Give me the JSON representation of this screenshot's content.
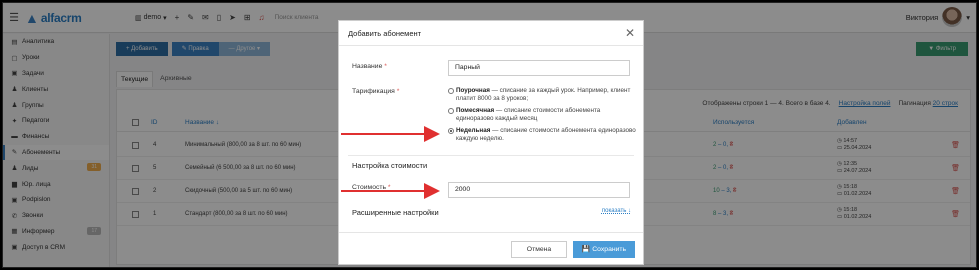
{
  "header": {
    "logo": "alfacrm",
    "branch": "demo",
    "search_placeholder": "Поиск клиента",
    "user_name": "Виктория"
  },
  "sidebar": {
    "items": [
      {
        "label": "Аналитика",
        "icon": "analytics-icon",
        "glyph": "▤"
      },
      {
        "label": "Уроки",
        "icon": "calendar-icon",
        "glyph": "▢"
      },
      {
        "label": "Задачи",
        "icon": "tasks-icon",
        "glyph": "▣"
      },
      {
        "label": "Клиенты",
        "icon": "user-icon",
        "glyph": "♟"
      },
      {
        "label": "Группы",
        "icon": "group-icon",
        "glyph": "♟"
      },
      {
        "label": "Педагоги",
        "icon": "teacher-icon",
        "glyph": "✦"
      },
      {
        "label": "Финансы",
        "icon": "money-icon",
        "glyph": "▬"
      },
      {
        "label": "Абонементы",
        "icon": "subscription-icon",
        "glyph": "✎",
        "active": true
      },
      {
        "label": "Лиды",
        "icon": "leads-icon",
        "glyph": "♟",
        "badge": "31"
      },
      {
        "label": "Юр. лица",
        "icon": "company-icon",
        "glyph": "▆"
      },
      {
        "label": "Podpislon",
        "icon": "sign-icon",
        "glyph": "▣"
      },
      {
        "label": "Звонки",
        "icon": "phone-icon",
        "glyph": "✆"
      },
      {
        "label": "Информер",
        "icon": "informer-icon",
        "glyph": "▦",
        "badge": "17",
        "badge_gray": true
      },
      {
        "label": "Доступ в CRM",
        "icon": "lock-icon",
        "glyph": "▣"
      }
    ]
  },
  "toolbar": {
    "add_label": "+ Добавить",
    "edit_label": "✎ Правка",
    "other_label": "— Другое ▾",
    "filter_label": "▼ Фильтр"
  },
  "tabs": [
    {
      "label": "Текущие",
      "active": true
    },
    {
      "label": "Архивные",
      "active": false
    }
  ],
  "pager": {
    "text": "Отображены строки 1 — 4. Всего в базе 4.",
    "columns_link": "Настройка полей",
    "pagination_label": "Пагинация",
    "per_page": "20 строк"
  },
  "table": {
    "columns": [
      "ID",
      "Название ↓",
      "Используется",
      "Добавлен"
    ],
    "rows": [
      {
        "id": "4",
        "name": "Минимальный (800,00 за 8 шт. по 60 мин)",
        "used_a": "2",
        "used_b": "0",
        "added_time": "◷ 14:57",
        "added_date": "▭ 25.04.2024"
      },
      {
        "id": "5",
        "name": "Семейный (6 500,00 за 8 шт. по 60 мин)",
        "used_a": "2",
        "used_b": "0",
        "added_time": "◷ 12:35",
        "added_date": "▭ 24.07.2024"
      },
      {
        "id": "2",
        "name": "Скидочный (500,00 за 5 шт. по 60 мин)",
        "used_a": "10",
        "used_b": "3",
        "added_time": "◷ 15:18",
        "added_date": "▭ 01.02.2024"
      },
      {
        "id": "1",
        "name": "Стандарт (800,00 за 8 шт. по 60 мин)",
        "used_a": "8",
        "used_b": "3",
        "added_time": "◷ 15:18",
        "added_date": "▭ 01.02.2024"
      }
    ]
  },
  "modal": {
    "title": "Добавить абонемент",
    "name_label": "Название",
    "name_value": "Парный",
    "tariff_label": "Тарификация",
    "tariff_options": [
      {
        "bold": "Поурочная",
        "text": " — списание за каждый урок. Например, клиент платит 8000 за 8 уроков;",
        "selected": false
      },
      {
        "bold": "Помесячная",
        "text": " — списание стоимости абонемента единоразово каждый месяц",
        "selected": false
      },
      {
        "bold": "Недельная",
        "text": " — списание стоимости абонемента единоразово каждую неделю.",
        "selected": true
      }
    ],
    "cost_section": "Настройка стоимости",
    "cost_label": "Стоимость",
    "cost_value": "2000",
    "advanced_section": "Расширенные настройки",
    "show_link": "показать ↓",
    "cancel_label": "Отмена",
    "save_label": "💾 Сохранить"
  },
  "colors": {
    "accent": "#3b82c4",
    "arrow": "#e03030",
    "save": "#4a9bd8",
    "filter": "#3a9b71"
  }
}
